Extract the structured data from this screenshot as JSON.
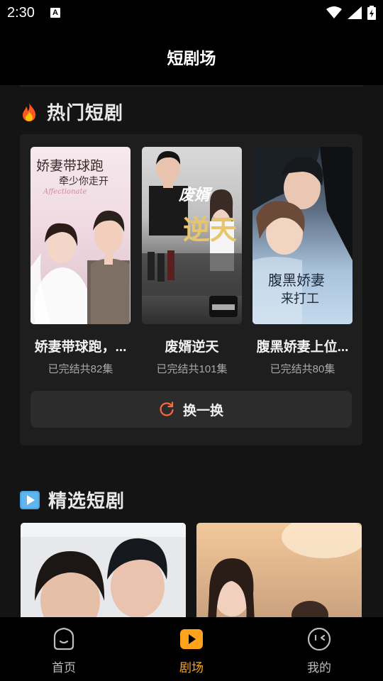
{
  "status": {
    "time": "2:30",
    "indicator": "A"
  },
  "header": {
    "title": "短剧场"
  },
  "hot": {
    "title": "热门短剧",
    "icon": "fire-icon",
    "items": [
      {
        "title": "娇妻带球跑，...",
        "subtitle": "已完结共82集",
        "poster_text": [
          "娇妻带球跑",
          "牵少你走开"
        ],
        "poster_en": "Affectionate"
      },
      {
        "title": "废婿逆天",
        "subtitle": "已完结共101集",
        "poster_text": [
          "废婿",
          "逆天"
        ]
      },
      {
        "title": "腹黑娇妻上位...",
        "subtitle": "已完结共80集",
        "poster_text": [
          "腹黑娇妻",
          "来打工"
        ]
      }
    ],
    "refresh_label": "换一换"
  },
  "picks": {
    "title": "精选短剧",
    "icon": "play-icon"
  },
  "nav": {
    "items": [
      {
        "label": "首页",
        "icon": "home-face-icon",
        "active": false
      },
      {
        "label": "剧场",
        "icon": "theater-play-icon",
        "active": true
      },
      {
        "label": "我的",
        "icon": "profile-face-icon",
        "active": false
      }
    ]
  },
  "colors": {
    "accent": "#ffa31a",
    "refresh_icon": "#ff6a3d",
    "card_bg": "#1e1e1e",
    "content_bg": "#141414"
  }
}
